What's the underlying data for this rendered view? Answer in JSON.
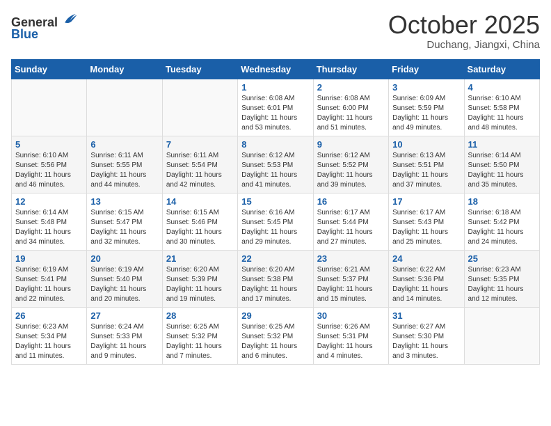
{
  "header": {
    "logo_line1": "General",
    "logo_line2": "Blue",
    "month": "October 2025",
    "location": "Duchang, Jiangxi, China"
  },
  "weekdays": [
    "Sunday",
    "Monday",
    "Tuesday",
    "Wednesday",
    "Thursday",
    "Friday",
    "Saturday"
  ],
  "weeks": [
    [
      {
        "day": "",
        "info": ""
      },
      {
        "day": "",
        "info": ""
      },
      {
        "day": "",
        "info": ""
      },
      {
        "day": "1",
        "info": "Sunrise: 6:08 AM\nSunset: 6:01 PM\nDaylight: 11 hours and 53 minutes."
      },
      {
        "day": "2",
        "info": "Sunrise: 6:08 AM\nSunset: 6:00 PM\nDaylight: 11 hours and 51 minutes."
      },
      {
        "day": "3",
        "info": "Sunrise: 6:09 AM\nSunset: 5:59 PM\nDaylight: 11 hours and 49 minutes."
      },
      {
        "day": "4",
        "info": "Sunrise: 6:10 AM\nSunset: 5:58 PM\nDaylight: 11 hours and 48 minutes."
      }
    ],
    [
      {
        "day": "5",
        "info": "Sunrise: 6:10 AM\nSunset: 5:56 PM\nDaylight: 11 hours and 46 minutes."
      },
      {
        "day": "6",
        "info": "Sunrise: 6:11 AM\nSunset: 5:55 PM\nDaylight: 11 hours and 44 minutes."
      },
      {
        "day": "7",
        "info": "Sunrise: 6:11 AM\nSunset: 5:54 PM\nDaylight: 11 hours and 42 minutes."
      },
      {
        "day": "8",
        "info": "Sunrise: 6:12 AM\nSunset: 5:53 PM\nDaylight: 11 hours and 41 minutes."
      },
      {
        "day": "9",
        "info": "Sunrise: 6:12 AM\nSunset: 5:52 PM\nDaylight: 11 hours and 39 minutes."
      },
      {
        "day": "10",
        "info": "Sunrise: 6:13 AM\nSunset: 5:51 PM\nDaylight: 11 hours and 37 minutes."
      },
      {
        "day": "11",
        "info": "Sunrise: 6:14 AM\nSunset: 5:50 PM\nDaylight: 11 hours and 35 minutes."
      }
    ],
    [
      {
        "day": "12",
        "info": "Sunrise: 6:14 AM\nSunset: 5:48 PM\nDaylight: 11 hours and 34 minutes."
      },
      {
        "day": "13",
        "info": "Sunrise: 6:15 AM\nSunset: 5:47 PM\nDaylight: 11 hours and 32 minutes."
      },
      {
        "day": "14",
        "info": "Sunrise: 6:15 AM\nSunset: 5:46 PM\nDaylight: 11 hours and 30 minutes."
      },
      {
        "day": "15",
        "info": "Sunrise: 6:16 AM\nSunset: 5:45 PM\nDaylight: 11 hours and 29 minutes."
      },
      {
        "day": "16",
        "info": "Sunrise: 6:17 AM\nSunset: 5:44 PM\nDaylight: 11 hours and 27 minutes."
      },
      {
        "day": "17",
        "info": "Sunrise: 6:17 AM\nSunset: 5:43 PM\nDaylight: 11 hours and 25 minutes."
      },
      {
        "day": "18",
        "info": "Sunrise: 6:18 AM\nSunset: 5:42 PM\nDaylight: 11 hours and 24 minutes."
      }
    ],
    [
      {
        "day": "19",
        "info": "Sunrise: 6:19 AM\nSunset: 5:41 PM\nDaylight: 11 hours and 22 minutes."
      },
      {
        "day": "20",
        "info": "Sunrise: 6:19 AM\nSunset: 5:40 PM\nDaylight: 11 hours and 20 minutes."
      },
      {
        "day": "21",
        "info": "Sunrise: 6:20 AM\nSunset: 5:39 PM\nDaylight: 11 hours and 19 minutes."
      },
      {
        "day": "22",
        "info": "Sunrise: 6:20 AM\nSunset: 5:38 PM\nDaylight: 11 hours and 17 minutes."
      },
      {
        "day": "23",
        "info": "Sunrise: 6:21 AM\nSunset: 5:37 PM\nDaylight: 11 hours and 15 minutes."
      },
      {
        "day": "24",
        "info": "Sunrise: 6:22 AM\nSunset: 5:36 PM\nDaylight: 11 hours and 14 minutes."
      },
      {
        "day": "25",
        "info": "Sunrise: 6:23 AM\nSunset: 5:35 PM\nDaylight: 11 hours and 12 minutes."
      }
    ],
    [
      {
        "day": "26",
        "info": "Sunrise: 6:23 AM\nSunset: 5:34 PM\nDaylight: 11 hours and 11 minutes."
      },
      {
        "day": "27",
        "info": "Sunrise: 6:24 AM\nSunset: 5:33 PM\nDaylight: 11 hours and 9 minutes."
      },
      {
        "day": "28",
        "info": "Sunrise: 6:25 AM\nSunset: 5:32 PM\nDaylight: 11 hours and 7 minutes."
      },
      {
        "day": "29",
        "info": "Sunrise: 6:25 AM\nSunset: 5:32 PM\nDaylight: 11 hours and 6 minutes."
      },
      {
        "day": "30",
        "info": "Sunrise: 6:26 AM\nSunset: 5:31 PM\nDaylight: 11 hours and 4 minutes."
      },
      {
        "day": "31",
        "info": "Sunrise: 6:27 AM\nSunset: 5:30 PM\nDaylight: 11 hours and 3 minutes."
      },
      {
        "day": "",
        "info": ""
      }
    ]
  ]
}
